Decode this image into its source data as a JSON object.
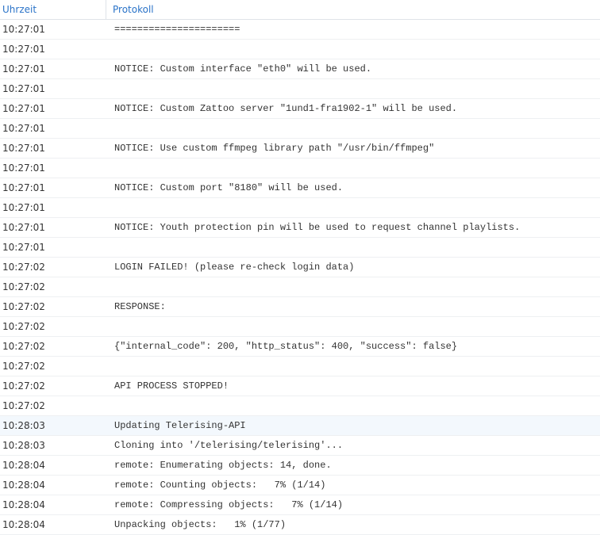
{
  "header": {
    "time_label": "Uhrzeit",
    "protocol_label": "Protokoll"
  },
  "rows": [
    {
      "time": "10:27:01",
      "message": "======================"
    },
    {
      "time": "10:27:01",
      "message": ""
    },
    {
      "time": "10:27:01",
      "message": "NOTICE: Custom interface \"eth0\" will be used."
    },
    {
      "time": "10:27:01",
      "message": ""
    },
    {
      "time": "10:27:01",
      "message": "NOTICE: Custom Zattoo server \"1und1-fra1902-1\" will be used."
    },
    {
      "time": "10:27:01",
      "message": ""
    },
    {
      "time": "10:27:01",
      "message": "NOTICE: Use custom ffmpeg library path \"/usr/bin/ffmpeg\""
    },
    {
      "time": "10:27:01",
      "message": ""
    },
    {
      "time": "10:27:01",
      "message": "NOTICE: Custom port \"8180\" will be used."
    },
    {
      "time": "10:27:01",
      "message": ""
    },
    {
      "time": "10:27:01",
      "message": "NOTICE: Youth protection pin will be used to request channel playlists."
    },
    {
      "time": "10:27:01",
      "message": ""
    },
    {
      "time": "10:27:02",
      "message": "LOGIN FAILED! (please re-check login data)"
    },
    {
      "time": "10:27:02",
      "message": ""
    },
    {
      "time": "10:27:02",
      "message": "RESPONSE:"
    },
    {
      "time": "10:27:02",
      "message": ""
    },
    {
      "time": "10:27:02",
      "message": "{\"internal_code\": 200, \"http_status\": 400, \"success\": false}"
    },
    {
      "time": "10:27:02",
      "message": ""
    },
    {
      "time": "10:27:02",
      "message": "API PROCESS STOPPED!"
    },
    {
      "time": "10:27:02",
      "message": ""
    },
    {
      "time": "10:28:03",
      "message": "Updating Telerising-API"
    },
    {
      "time": "10:28:03",
      "message": "Cloning into '/telerising/telerising'..."
    },
    {
      "time": "10:28:04",
      "message": "remote: Enumerating objects: 14, done."
    },
    {
      "time": "10:28:04",
      "message": "remote: Counting objects:   7% (1/14)"
    },
    {
      "time": "10:28:04",
      "message": "remote: Compressing objects:   7% (1/14)"
    },
    {
      "time": "10:28:04",
      "message": "Unpacking objects:   1% (1/77)"
    }
  ]
}
